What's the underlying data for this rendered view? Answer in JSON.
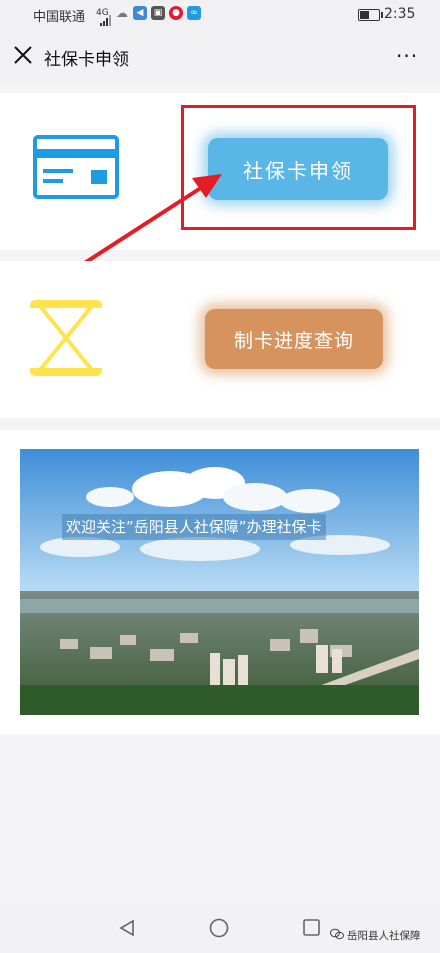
{
  "status_bar": {
    "carrier": "中国联通",
    "network": "4G",
    "time": "2:35"
  },
  "nav": {
    "title": "社保卡申领",
    "more": "···"
  },
  "actions": {
    "apply_label": "社保卡申领",
    "query_label": "制卡进度查询"
  },
  "banner": {
    "caption": "欢迎关注”岳阳县人社保障”办理社保卡"
  },
  "watermark": {
    "text": "岳阳县人社保障"
  },
  "colors": {
    "apply_button": "#5ab6e6",
    "query_button": "#d7935d",
    "card_icon": "#1e9be3",
    "hourglass_icon": "#ffe34d",
    "annotation_red": "#e51c23"
  }
}
